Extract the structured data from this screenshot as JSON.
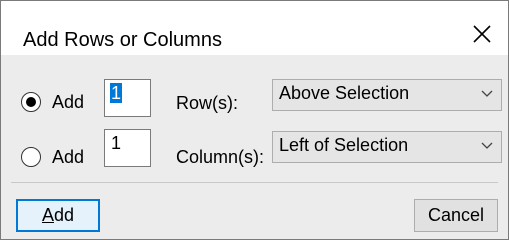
{
  "dialog": {
    "title": "Add Rows or Columns",
    "close_icon": "close-icon"
  },
  "rows_option": {
    "radio_label": "Add",
    "checked": true,
    "count_value": "1",
    "count_selected": true,
    "field_label": "Row(s):",
    "position_value": "Above Selection"
  },
  "columns_option": {
    "radio_label": "Add",
    "checked": false,
    "count_value": "1",
    "field_label": "Column(s):",
    "position_value": "Left of Selection"
  },
  "buttons": {
    "add_first_letter": "A",
    "add_rest": "dd",
    "cancel_label": "Cancel"
  },
  "colors": {
    "accent": "#0078d7",
    "panel": "#ececec"
  }
}
